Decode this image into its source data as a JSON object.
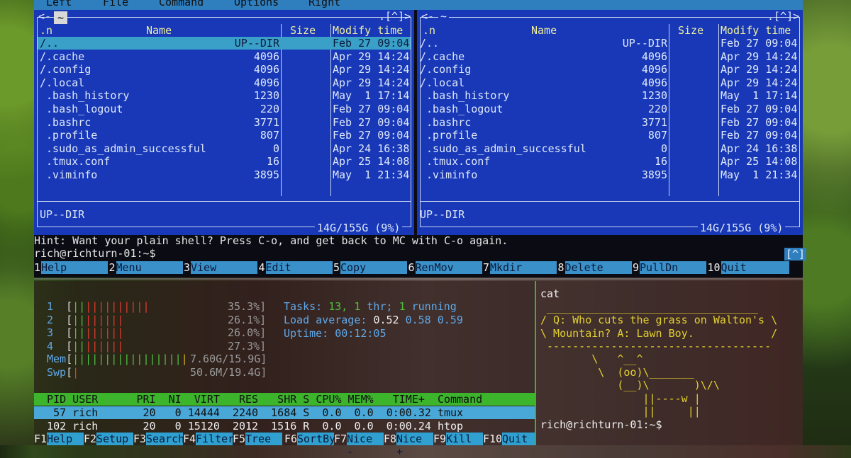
{
  "menubar": {
    "items": [
      "Left",
      "File",
      "Command",
      "Options",
      "Right"
    ]
  },
  "left_panel": {
    "path": "~",
    "corner": ".[^]>",
    "nav": "<-",
    "columns": {
      "n": ".n",
      "name": "Name",
      "size": "Size",
      "modify": "Modify time"
    },
    "rows": [
      {
        "name": "/..",
        "size": "UP--DIR",
        "modify": "Feb 27 09:04"
      },
      {
        "name": "/.cache",
        "size": "4096",
        "modify": "Apr 29 14:24"
      },
      {
        "name": "/.config",
        "size": "4096",
        "modify": "Apr 29 14:24"
      },
      {
        "name": "/.local",
        "size": "4096",
        "modify": "Apr 29 14:24"
      },
      {
        "name": " .bash_history",
        "size": "1230",
        "modify": "May  1 17:14"
      },
      {
        "name": " .bash_logout",
        "size": "220",
        "modify": "Feb 27 09:04"
      },
      {
        "name": " .bashrc",
        "size": "3771",
        "modify": "Feb 27 09:04"
      },
      {
        "name": " .profile",
        "size": "807",
        "modify": "Feb 27 09:04"
      },
      {
        "name": " .sudo_as_admin_successful",
        "size": "0",
        "modify": "Apr 24 16:38"
      },
      {
        "name": " .tmux.conf",
        "size": "16",
        "modify": "Apr 25 14:08"
      },
      {
        "name": " .viminfo",
        "size": "3895",
        "modify": "May  1 21:34"
      }
    ],
    "status": "UP--DIR",
    "disk": "14G/155G (9%)"
  },
  "right_panel": {
    "path": "~",
    "corner": ".[^]>",
    "nav": "<-",
    "columns": {
      "n": ".n",
      "name": "Name",
      "size": "Size",
      "modify": "Modify time"
    },
    "rows": [
      {
        "name": "/..",
        "size": "UP--DIR",
        "modify": "Feb 27 09:04"
      },
      {
        "name": "/.cache",
        "size": "4096",
        "modify": "Apr 29 14:24"
      },
      {
        "name": "/.config",
        "size": "4096",
        "modify": "Apr 29 14:24"
      },
      {
        "name": "/.local",
        "size": "4096",
        "modify": "Apr 29 14:24"
      },
      {
        "name": " .bash_history",
        "size": "1230",
        "modify": "May  1 17:14"
      },
      {
        "name": " .bash_logout",
        "size": "220",
        "modify": "Feb 27 09:04"
      },
      {
        "name": " .bashrc",
        "size": "3771",
        "modify": "Feb 27 09:04"
      },
      {
        "name": " .profile",
        "size": "807",
        "modify": "Feb 27 09:04"
      },
      {
        "name": " .sudo_as_admin_successful",
        "size": "0",
        "modify": "Apr 24 16:38"
      },
      {
        "name": " .tmux.conf",
        "size": "16",
        "modify": "Apr 25 14:08"
      },
      {
        "name": " .viminfo",
        "size": "3895",
        "modify": "May  1 21:34"
      }
    ],
    "status": "UP--DIR",
    "disk": "14G/155G (9%)"
  },
  "hint": "Hint: Want your plain shell? Press C-o, and get back to MC with C-o again.",
  "prompt": "rich@richturn-01:~$",
  "prompt_marker": "[^]",
  "fkeys": [
    {
      "num": "1",
      "label": "Help"
    },
    {
      "num": "2",
      "label": "Menu"
    },
    {
      "num": "3",
      "label": "View"
    },
    {
      "num": "4",
      "label": "Edit"
    },
    {
      "num": "5",
      "label": "Copy"
    },
    {
      "num": "6",
      "label": "RenMov"
    },
    {
      "num": "7",
      "label": "Mkdir"
    },
    {
      "num": "8",
      "label": "Delete"
    },
    {
      "num": "9",
      "label": "PullDn"
    },
    {
      "num": "10",
      "label": "Quit"
    }
  ],
  "htop": {
    "cpus": [
      {
        "id": "1",
        "bar": "||||||||||||",
        "pct": "35.3%]"
      },
      {
        "id": "2",
        "bar": "||||||||",
        "pct": "26.1%]"
      },
      {
        "id": "3",
        "bar": "||||||||",
        "pct": "26.0%]"
      },
      {
        "id": "4",
        "bar": "||||||||",
        "pct": "27.3%]"
      }
    ],
    "mem": {
      "label": "Mem",
      "bar": "||||||||||||||||||",
      "value": "7.60G/15.9G]"
    },
    "swp": {
      "label": "Swp",
      "bar": "|",
      "value": "50.6M/19.4G]"
    },
    "tasks_label": "Tasks:",
    "tasks_count": "13,",
    "thr_count": "1",
    "thr_label": "thr;",
    "running_count": "1",
    "running_label": "running",
    "load_label": "Load average:",
    "load1": "0.52",
    "load5": "0.58",
    "load15": "0.59",
    "uptime_label": "Uptime:",
    "uptime": "00:12:05",
    "proc_header": "  PID USER      PRI  NI  VIRT   RES   SHR S CPU% MEM%   TIME+  Command",
    "processes": [
      "   57 rich       20   0 14444  2240  1684 S  0.0  0.0  0:00.32 tmux",
      "  102 rich       20   0 15120  2012  1516 R  0.0  0.0  0:00.24 htop"
    ],
    "fkeys": [
      {
        "num": "F1",
        "label": "Help"
      },
      {
        "num": "F2",
        "label": "Setup"
      },
      {
        "num": "F3",
        "label": "Search"
      },
      {
        "num": "F4",
        "label": "Filter"
      },
      {
        "num": "F5",
        "label": "Tree"
      },
      {
        "num": "F6",
        "label": "SortBy"
      },
      {
        "num": "F7",
        "label": "Nice -"
      },
      {
        "num": "F8",
        "label": "Nice +"
      },
      {
        "num": "F9",
        "label": "Kill"
      },
      {
        "num": "F10",
        "label": "Quit"
      }
    ]
  },
  "cowsay": {
    "command": "cat",
    "top": " _________________________________",
    "line1": "/ Q: Who cuts the grass on Walton's \\",
    "line2": "\\ Mountain? A: Lawn Boy.            /",
    "bottom": " -----------------------------------",
    "cow1": "        \\   ^__^",
    "cow2": "         \\  (oo)\\_______",
    "cow3": "            (__)\\       )\\/\\",
    "cow4": "                ||----w |",
    "cow5": "                ||     ||",
    "prompt": "rich@richturn-01:~$"
  },
  "colors": {
    "panel_blue": "#1838b8",
    "selection": "#3aa0c8",
    "menubar": "#2f7fbf",
    "htop_green": "#3cb42c",
    "cow_yellow": "#e2d030"
  }
}
